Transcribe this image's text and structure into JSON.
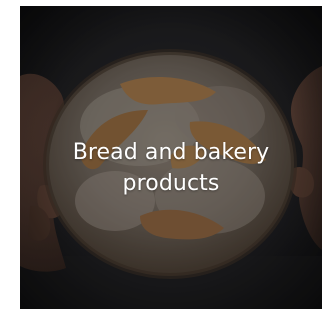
{
  "category_card": {
    "title_line1": "Bread and bakery",
    "title_line2": "products",
    "image_subject": "bread-loaf-in-hands-photo"
  }
}
